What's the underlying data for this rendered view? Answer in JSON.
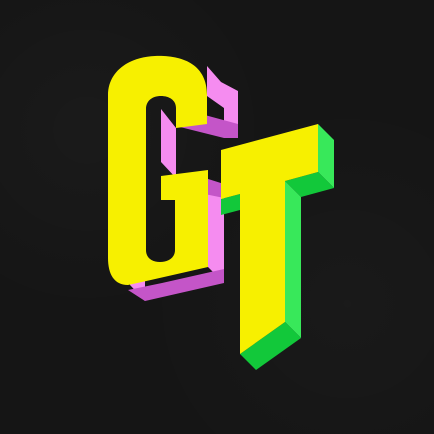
{
  "logo": {
    "text": "GT",
    "icon_name": "gt-app-icon",
    "colors": {
      "background": "#151515",
      "letter_face": "#f7f000",
      "g_depth_light": "#f58cf0",
      "g_depth_dark": "#c455c8",
      "t_depth_light": "#38e85a",
      "t_depth_dark": "#12c83a"
    }
  }
}
